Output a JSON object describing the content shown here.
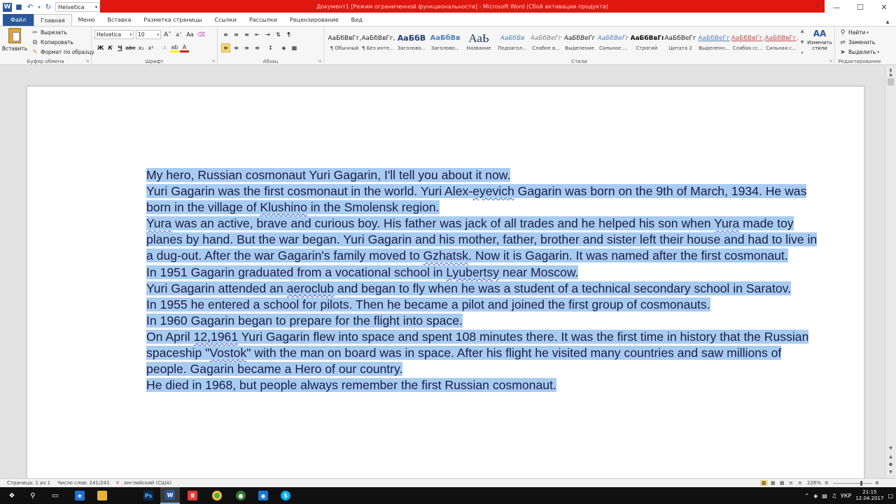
{
  "titlebar": {
    "qat_font": "Helvetica",
    "window_title": "Документ1 [Режим ограниченной функциональности] - Microsoft Word (Сбой активации продукта)",
    "minimize": "—",
    "maximize": "☐",
    "close": "✕"
  },
  "tabs": [
    "Файл",
    "Главная",
    "Меню",
    "Вставка",
    "Разметка страницы",
    "Ссылки",
    "Рассылки",
    "Рецензирование",
    "Вид"
  ],
  "ribbon": {
    "clipboard": {
      "paste": "Вставить",
      "cut": "Вырезать",
      "copy": "Копировать",
      "format_painter": "Формат по образцу",
      "label": "Буфер обмена"
    },
    "font": {
      "name": "Helvetica",
      "size": "10",
      "label": "Шрифт"
    },
    "paragraph": {
      "label": "Абзац"
    },
    "styles": {
      "label": "Стили",
      "items": [
        {
          "preview": "АаБбВвГг,",
          "name": "¶ Обычный",
          "color": "#222222"
        },
        {
          "preview": "АаБбВвГг,",
          "name": "¶ Без инте...",
          "color": "#222222"
        },
        {
          "preview": "АаБбВ",
          "name": "Заголово...",
          "color": "#1f3d7a"
        },
        {
          "preview": "АаБбВв",
          "name": "Заголово...",
          "color": "#4f81bd"
        },
        {
          "preview": "АаЬ",
          "name": "Название",
          "color": "#17365d"
        },
        {
          "preview": "АаБбВв",
          "name": "Подзагол...",
          "color": "#4f81bd"
        },
        {
          "preview": "АаБбВеГг",
          "name": "Слабое в...",
          "color": "#808080"
        },
        {
          "preview": "АаБбВеГг",
          "name": "Выделение",
          "color": "#222222"
        },
        {
          "preview": "АаБбВеГг",
          "name": "Сильное ...",
          "color": "#4f81bd"
        },
        {
          "preview": "АаБбВвГг,",
          "name": "Строгий",
          "color": "#111111"
        },
        {
          "preview": "АаБбВеГг",
          "name": "Цитата 2",
          "color": "#222222"
        },
        {
          "preview": "АаБбВеГг",
          "name": "Выделенн...",
          "color": "#4f81bd"
        },
        {
          "preview": "АаБбВвГг,",
          "name": "Слабая сс...",
          "color": "#c0504d"
        },
        {
          "preview": "АаБбВвГг,",
          "name": "Сильная с...",
          "color": "#c0504d"
        }
      ],
      "change": "Изменить стили"
    },
    "editing": {
      "find": "Найти",
      "replace": "Заменить",
      "select": "Выделить",
      "label": "Редактирование"
    }
  },
  "document": {
    "paragraphs": [
      [
        {
          "t": "My hero, Russian cosmonaut Yuri Gagarin, I'll tell you about it now. "
        }
      ],
      [
        {
          "t": "Yuri Gagarin was the first cosmonaut in the world. Yuri Alex-"
        },
        {
          "t": "eyevich",
          "sq": true
        },
        {
          "t": " Gagarin was born on the 9th of March, 1934. He was born in the village of "
        },
        {
          "t": "Klushino",
          "sq": true
        },
        {
          "t": " in the Smolensk region. "
        }
      ],
      [
        {
          "t": "Yura",
          "sq": true
        },
        {
          "t": " was an active, brave and curious boy. His father was jack of all trades and he helped his son when "
        },
        {
          "t": "Yura",
          "sq": true
        },
        {
          "t": " made toy planes by hand. But the war began. Yuri Gagarin and his mother, father, brother and sister left their house and had to live in a dug-out. After the war Gagarin's family moved to "
        },
        {
          "t": "Gzhatsk",
          "sq": true
        },
        {
          "t": ". Now it is Gagarin. It was named after the first cosmonaut. "
        }
      ],
      [
        {
          "t": "In 1951 Gagarin graduated from a vocational school in "
        },
        {
          "t": "Lyubertsy",
          "sq": true
        },
        {
          "t": " near Moscow. "
        }
      ],
      [
        {
          "t": "Yuri Gagarin attended an "
        },
        {
          "t": "aeroclub",
          "sq": true
        },
        {
          "t": " and began to fly when he was a student of a technical secondary school in Saratov. "
        }
      ],
      [
        {
          "t": "In 1955 he entered a school for pilots. Then he became a pilot and joined the first group of cosmonauts. "
        }
      ],
      [
        {
          "t": "In 1960 Gagarin began to prepare for the flight into space. "
        }
      ],
      [
        {
          "t": "On April "
        },
        {
          "t": "12,1961",
          "sq": true
        },
        {
          "t": " Yuri Gagarin flew into space and spent 108 minutes there. It was the first time in history that the Russian spaceship \""
        },
        {
          "t": "Vostok",
          "sq": true
        },
        {
          "t": "\" with the man on board was in space. After his flight he visited many countries and saw millions of people. Gagarin became a Hero of our country. "
        }
      ],
      [
        {
          "t": "He died in 1968, but people always remember the first Russian cosmonaut. "
        }
      ]
    ]
  },
  "statusbar": {
    "page": "Страница: 1 из 1",
    "words": "Число слов: 241/241",
    "language": "английский (США)",
    "zoom": "226%"
  },
  "taskbar": {
    "language": "УКР",
    "time": "21:15",
    "date": "12.04.2017"
  },
  "colors": {
    "accent": "#2b579a",
    "activation_bar": "#e0170f",
    "selection": "#a8ccf0"
  }
}
